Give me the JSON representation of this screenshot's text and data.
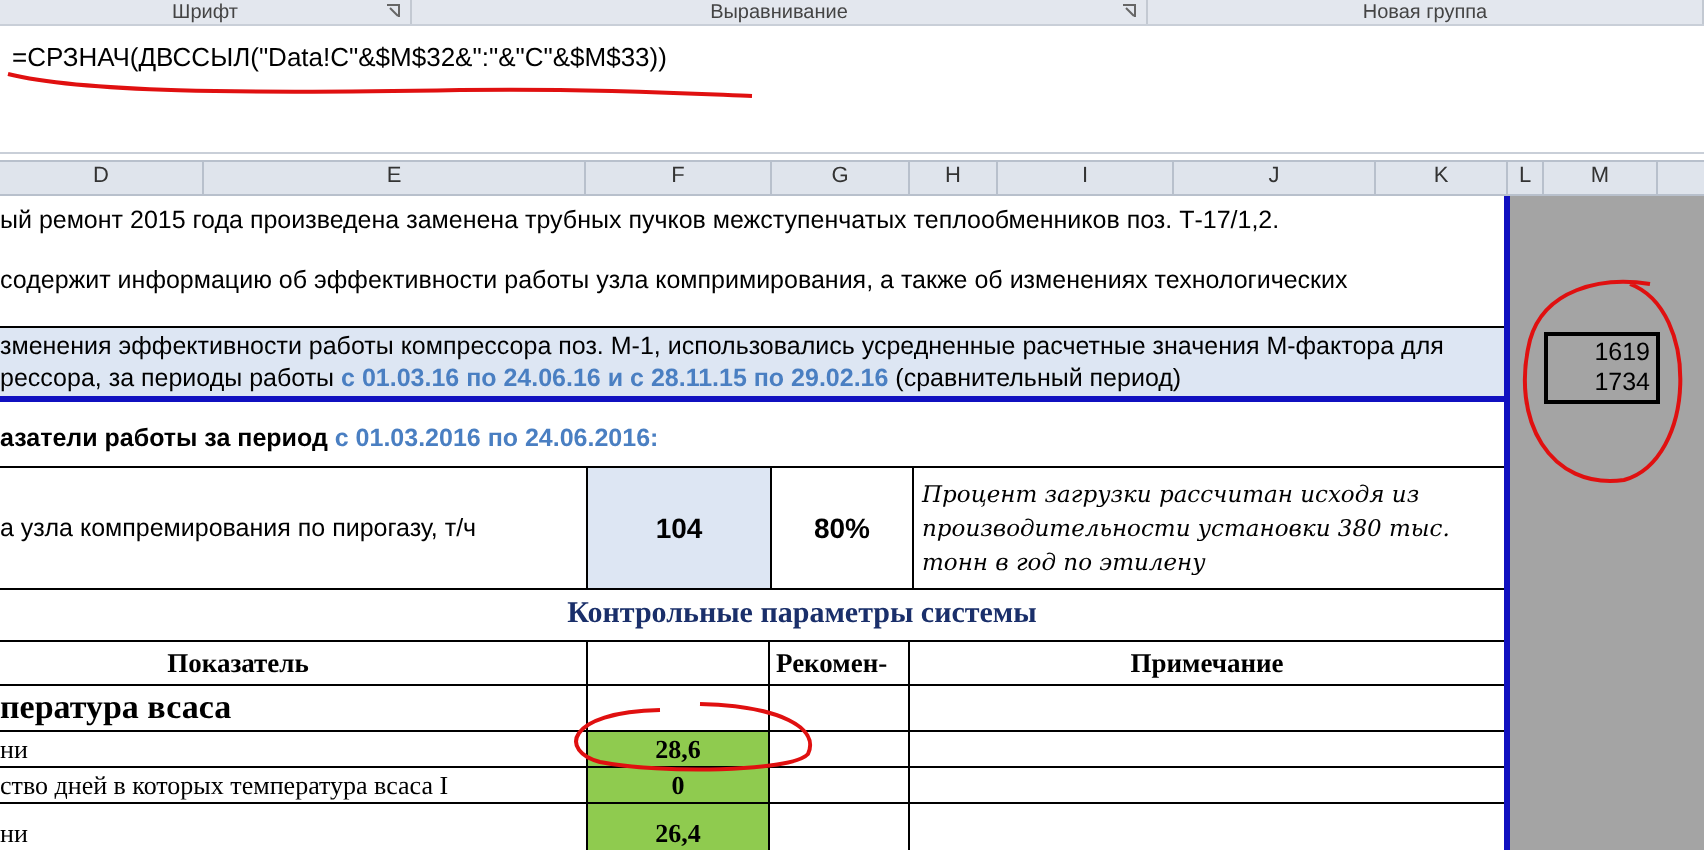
{
  "ribbon_groups": [
    {
      "label": "Шрифт",
      "launcher": true
    },
    {
      "label": "Выравнивание",
      "launcher": true
    },
    {
      "label": "Новая группа",
      "launcher": false
    }
  ],
  "formula_bar": {
    "formula": "=СРЗНАЧ(ДВССЫЛ(\"Data!C\"&$M$32&\":\"&\"C\"&$M$33))"
  },
  "column_headers": [
    "D",
    "E",
    "F",
    "G",
    "H",
    "I",
    "J",
    "K",
    "L",
    "M"
  ],
  "intro_lines": [
    "ый ремонт 2015 года произведена заменена трубных пучков межступенчатых теплообменников поз. Т-17/1,2.",
    "содержит информацию об эффективности работы узла компримирования, а также об изменениях технологических"
  ],
  "method_note": [
    [
      {
        "kind": "plain",
        "text": "зменения эффективности работы компрессора поз. М-1, использовались усредненные расчетные значения М-фактора для"
      }
    ],
    [
      {
        "kind": "plain",
        "text": "рессора, за периоды работы "
      },
      {
        "kind": "date",
        "text": "с 01.03.16 по 24.06.16 и с 28.11.15 по 29.02.16"
      },
      {
        "kind": "plain",
        "text": " (сравнительный период)"
      }
    ]
  ],
  "period_heading": [
    {
      "kind": "plain",
      "text": "азатели работы за период "
    },
    {
      "kind": "date",
      "text": "с 01.03.2016 по 24.06.2016:"
    }
  ],
  "load_row": {
    "label": "а узла компремирования по пирогазу, т/ч",
    "value": "104",
    "percent": "80%",
    "note": "Процент загрузки рассчитан исходя из производительности установки 380 тыс. тонн в год по этилену"
  },
  "control_params": {
    "title": "Контрольные параметры системы",
    "columns": [
      "Показатель",
      "Рекомен-",
      "Примечание"
    ],
    "section": "пература всаса",
    "rows": [
      {
        "label": "ни",
        "value": "28,6"
      },
      {
        "label": "ство дней в которых температура всаса I",
        "value": "0"
      },
      {
        "label": "ни",
        "value": "26,4"
      }
    ]
  },
  "side_cells": [
    "1619",
    "1734"
  ]
}
